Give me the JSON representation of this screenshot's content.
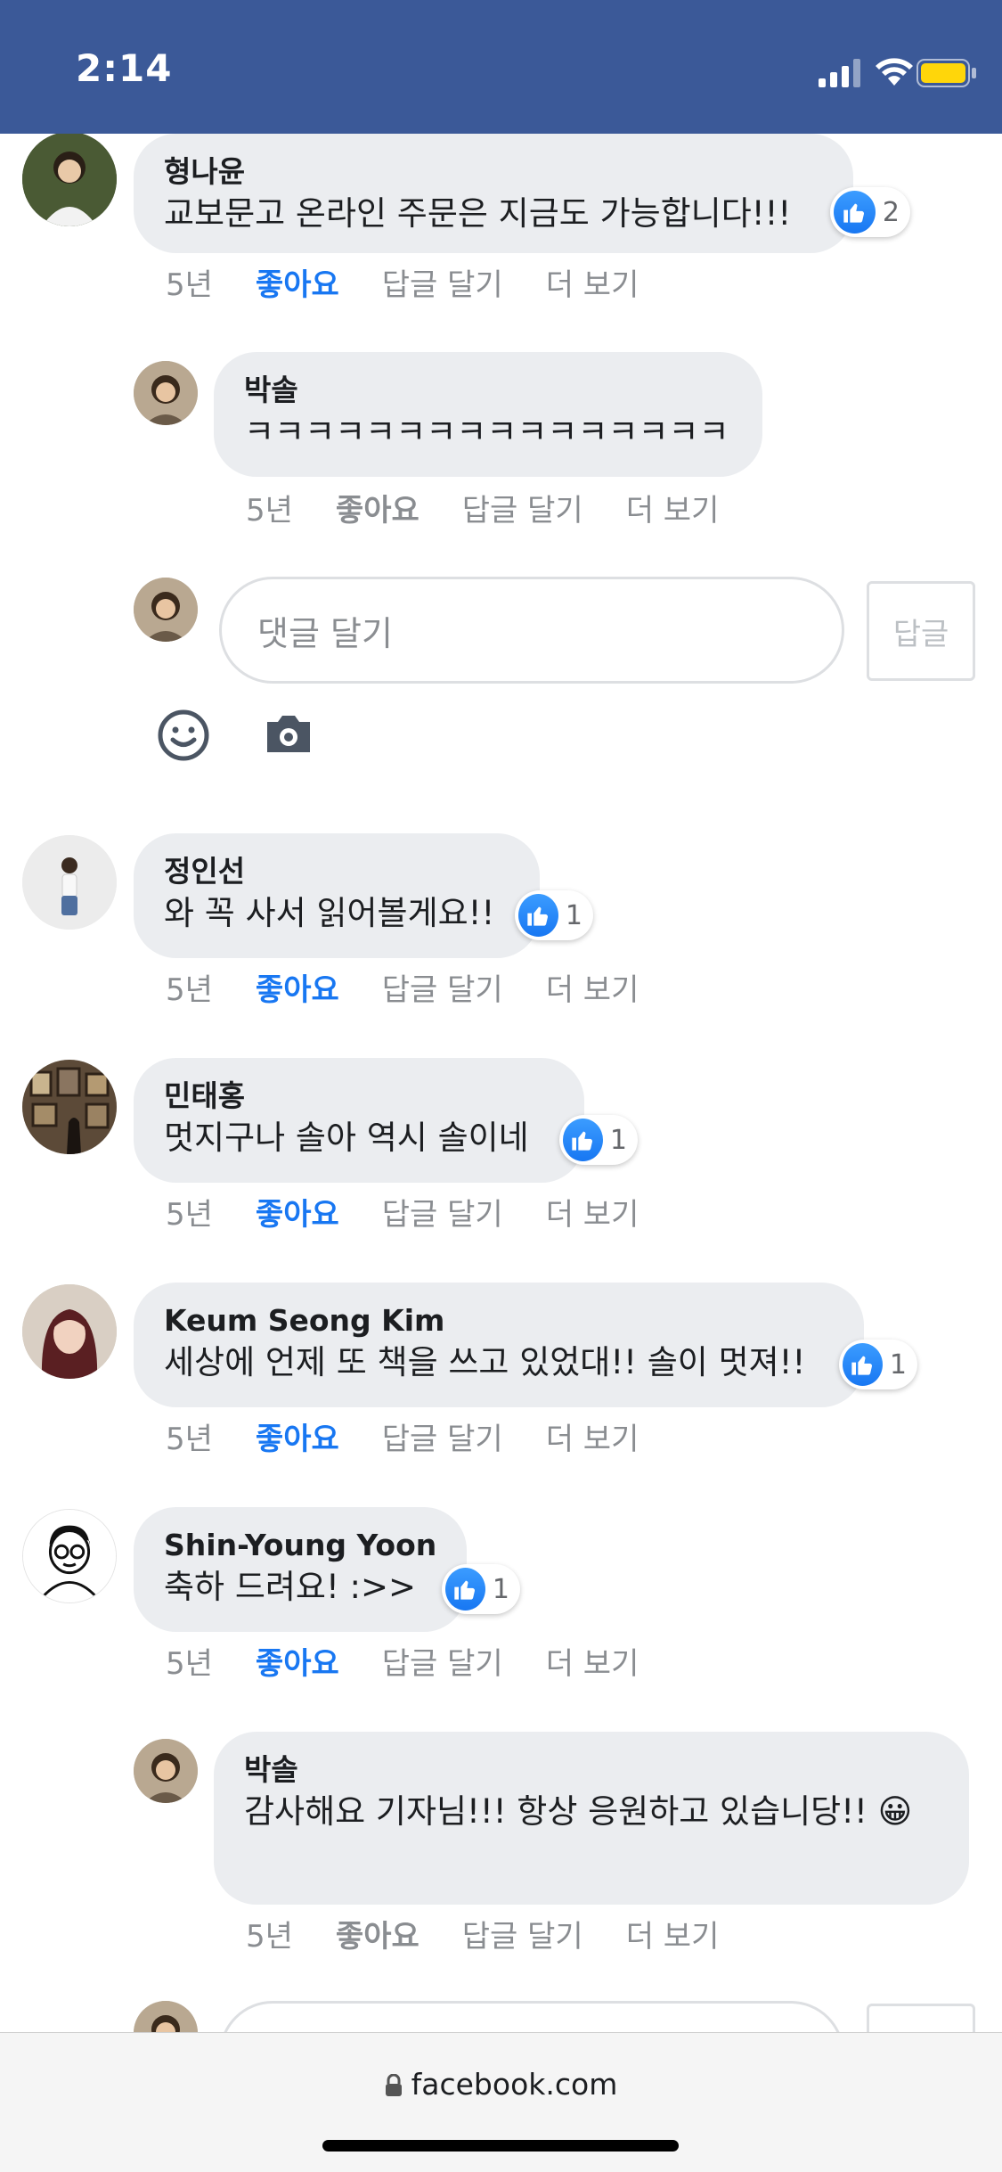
{
  "status_bar": {
    "time": "2:14"
  },
  "comments": [
    {
      "author": "형나윤",
      "text": "교보문고 온라인 주문은 지금도 가능합니다!!!",
      "reactions": "2",
      "time": "5년",
      "like": "좋아요",
      "reply": "답글 달기",
      "more": "더 보기"
    },
    {
      "author": "박솔",
      "text": "ㅋㅋㅋㅋㅋㅋㅋㅋㅋㅋㅋㅋㅋㅋㅋㅋ",
      "time": "5년",
      "like": "좋아요",
      "reply": "답글 달기",
      "more": "더 보기"
    },
    {
      "author": "정인선",
      "text": "와 꼭 사서 읽어볼게요!!",
      "reactions": "1",
      "time": "5년",
      "like": "좋아요",
      "reply": "답글 달기",
      "more": "더 보기"
    },
    {
      "author": "민태홍",
      "text": "멋지구나 솔아 역시 솔이네",
      "reactions": "1",
      "time": "5년",
      "like": "좋아요",
      "reply": "답글 달기",
      "more": "더 보기"
    },
    {
      "author": "Keum Seong Kim",
      "text": "세상에 언제 또 책을 쓰고 있었대!! 솔이 멋져!!",
      "reactions": "1",
      "time": "5년",
      "like": "좋아요",
      "reply": "답글 달기",
      "more": "더 보기"
    },
    {
      "author": "Shin-Young Yoon",
      "text": "축하 드려요! :>>",
      "reactions": "1",
      "time": "5년",
      "like": "좋아요",
      "reply": "답글 달기",
      "more": "더 보기"
    },
    {
      "author": "박솔",
      "text": "감사해요 기자님!!! 항상 응원하고 있습니당!! 😀",
      "time": "5년",
      "like": "좋아요",
      "reply": "답글 달기",
      "more": "더 보기"
    }
  ],
  "composer": {
    "placeholder": "댓글 달기",
    "submit_label": "답글"
  },
  "url_bar": {
    "domain": "facebook.com"
  }
}
